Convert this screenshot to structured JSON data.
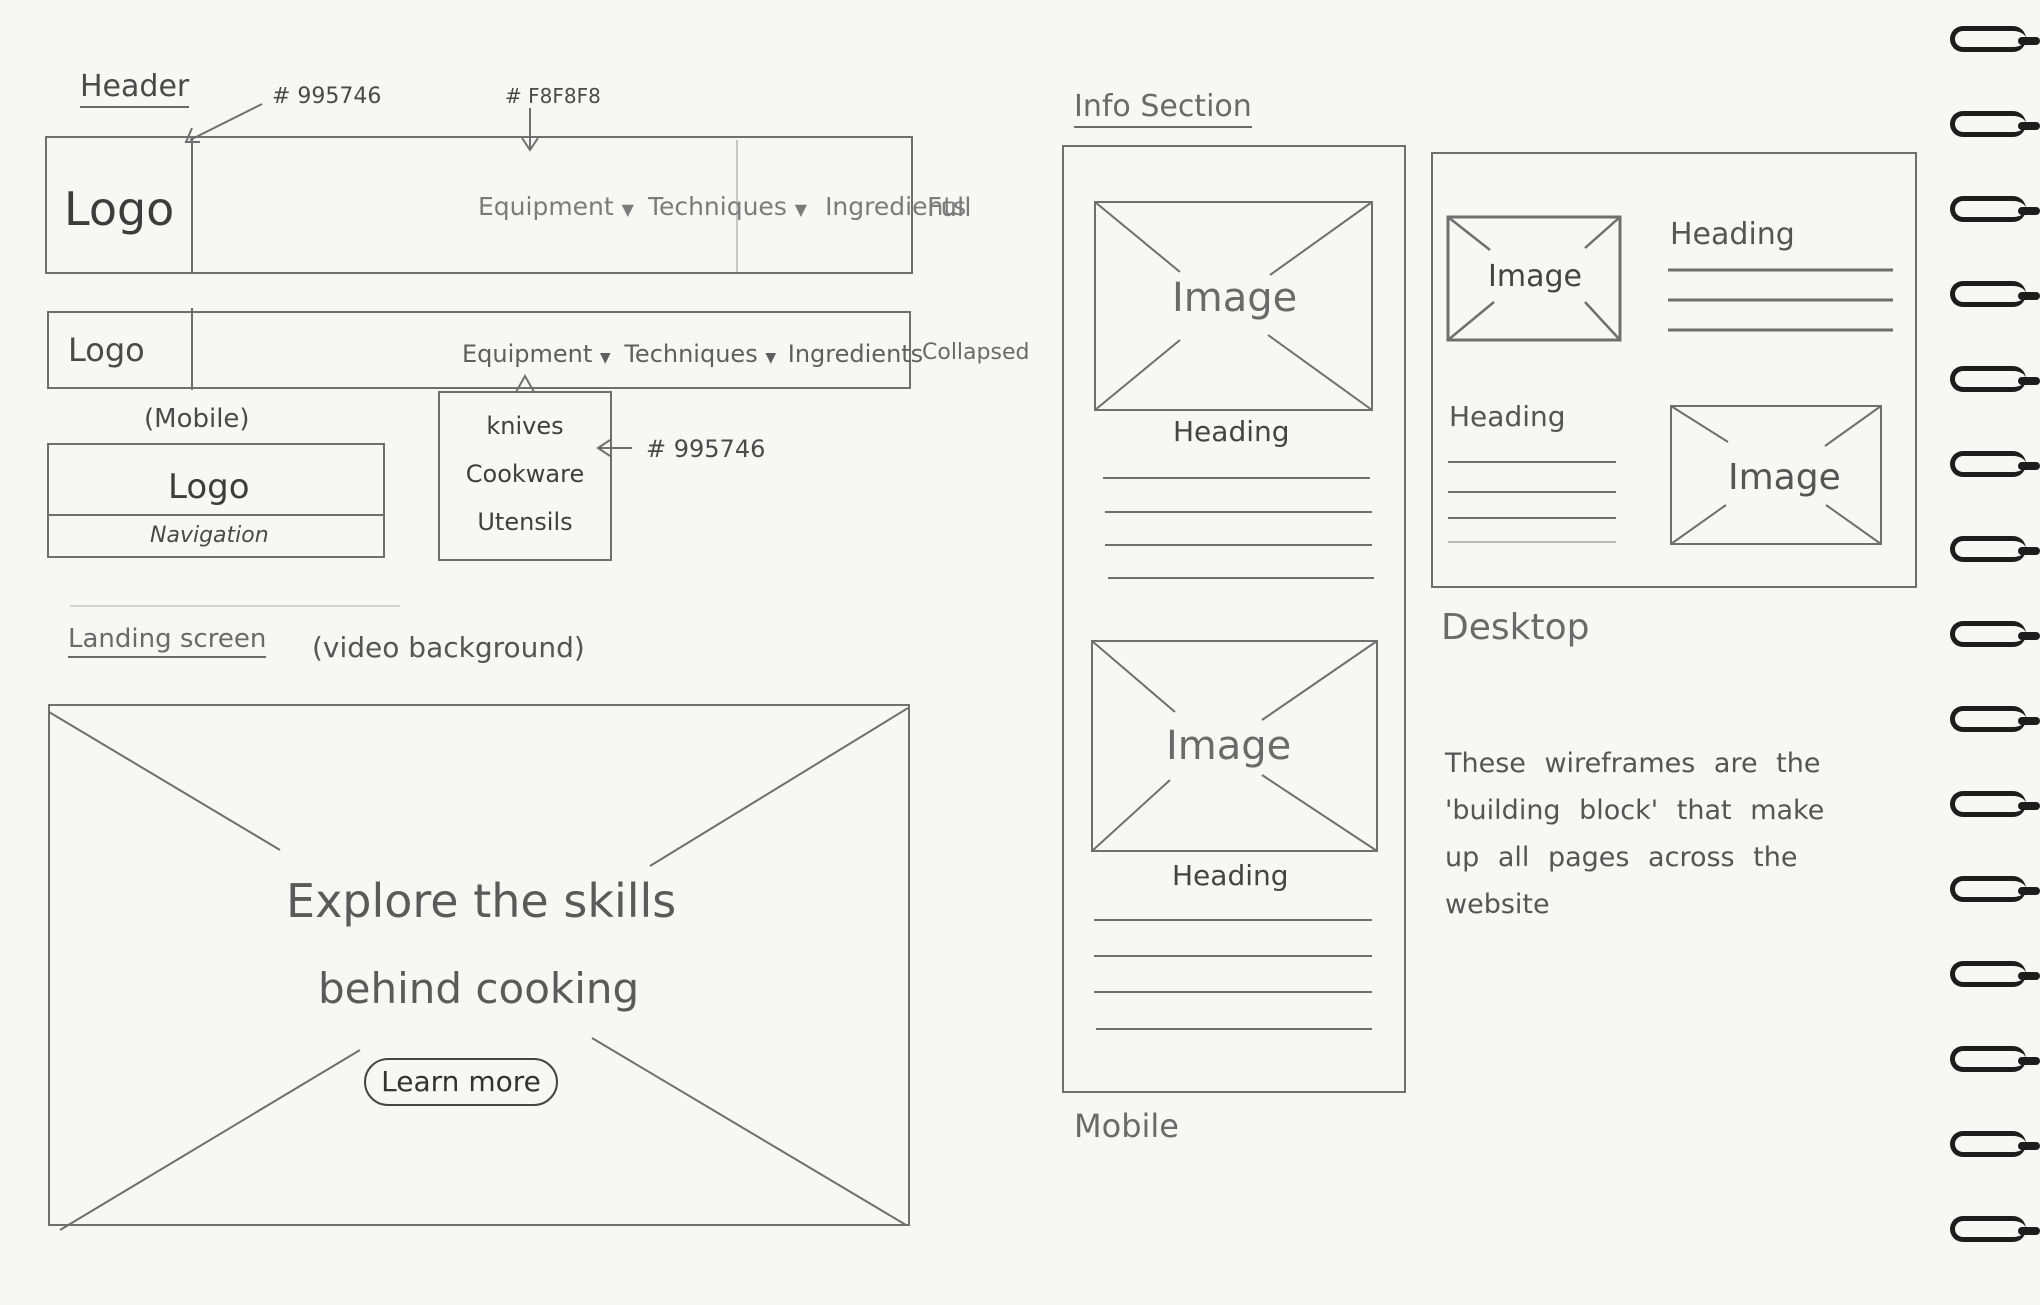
{
  "header_section": {
    "title": "Header",
    "color_logo_border": "#995746",
    "color_nav_bg": "#F8F8F8",
    "full": {
      "logo": "Logo",
      "nav": [
        "Equipment",
        "Techniques",
        "Ingredients"
      ],
      "state_label": "Full"
    },
    "collapsed": {
      "logo": "Logo",
      "nav": [
        "Equipment",
        "Techniques",
        "Ingredients"
      ],
      "state_label": "Collapsed"
    },
    "dropdown": {
      "items": [
        "knives",
        "Cookware",
        "Utensils"
      ],
      "color": "#995746"
    },
    "mobile": {
      "label": "(Mobile)",
      "logo": "Logo",
      "navigation": "Navigation"
    },
    "color_label_1": "# 995746",
    "color_label_2": "# F8F8F8",
    "color_label_3": "# 995746"
  },
  "landing_section": {
    "title": "Landing screen",
    "note": "(video background)",
    "headline_line1": "Explore the skills",
    "headline_line2": "behind cooking",
    "button_label": "Learn more"
  },
  "info_section": {
    "title": "Info Section",
    "mobile": {
      "cards": [
        {
          "image": "Image",
          "heading": "Heading"
        },
        {
          "image": "Image",
          "heading": "Heading"
        }
      ],
      "label": "Mobile"
    },
    "desktop": {
      "rows": [
        {
          "image": "Image",
          "heading": "Heading"
        },
        {
          "image": "Image",
          "heading": "Heading"
        }
      ],
      "label": "Desktop"
    },
    "note_lines": [
      "These wireframes are the",
      "'building block' that make",
      "up all pages across the",
      "website"
    ]
  }
}
